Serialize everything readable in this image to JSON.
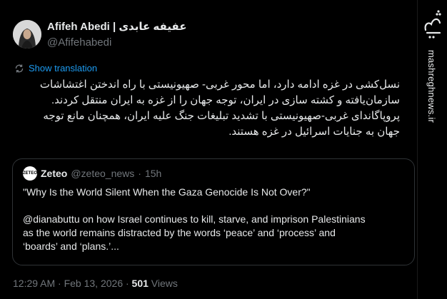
{
  "tweet": {
    "display_name": "Afifeh Abedi | عفیفه عابدی",
    "handle": "@Afifehabedi",
    "show_translation": "Show translation",
    "text_lines": [
      "نسل‌کشی در غزه ادامه دارد، اما محور غربی- صهیونیستی با راه اندختن اغتشاشات",
      "سازمان‌یافته و کشته سازی در ایران، توجه جهان را از غزه به ایران منتقل کردند.",
      "پروپاگاندای غربی-صهیونیستی با تشدید تبلیغات جنگ علیه ایران، همچنان مانع توجه",
      "جهان به جنایات اسرائیل در غزه هستند."
    ],
    "timestamp": "12:29 AM · Feb 13, 2026 · ",
    "views_count": "501",
    "views_label": " Views"
  },
  "quote": {
    "avatar_text": "ZETEO",
    "name": "Zeteo",
    "handle": "@zeteo_news",
    "separator": "·",
    "time": "15h",
    "line1": "\"Why Is the World Silent When the Gaza Genocide Is Not Over?\"",
    "line2": "@dianabuttu on how Israel continues to kill, starve, and imprison Palestinians",
    "line3": "as the world remains distracted by the words ‘peace’ and ‘process’ and",
    "line4": "‘boards’ and ‘plans.’..."
  },
  "watermark": {
    "site": "mashreghnews.ir",
    "logo_text": "مشرق"
  },
  "icons": {
    "translate": "translate-icon",
    "avatar": "avatar-portrait",
    "logo": "mashregh-logo-icon"
  },
  "colors": {
    "background": "#000000",
    "text": "#e7e9ea",
    "muted": "#71767b",
    "link": "#1d9bf0",
    "border": "#2f3336"
  }
}
